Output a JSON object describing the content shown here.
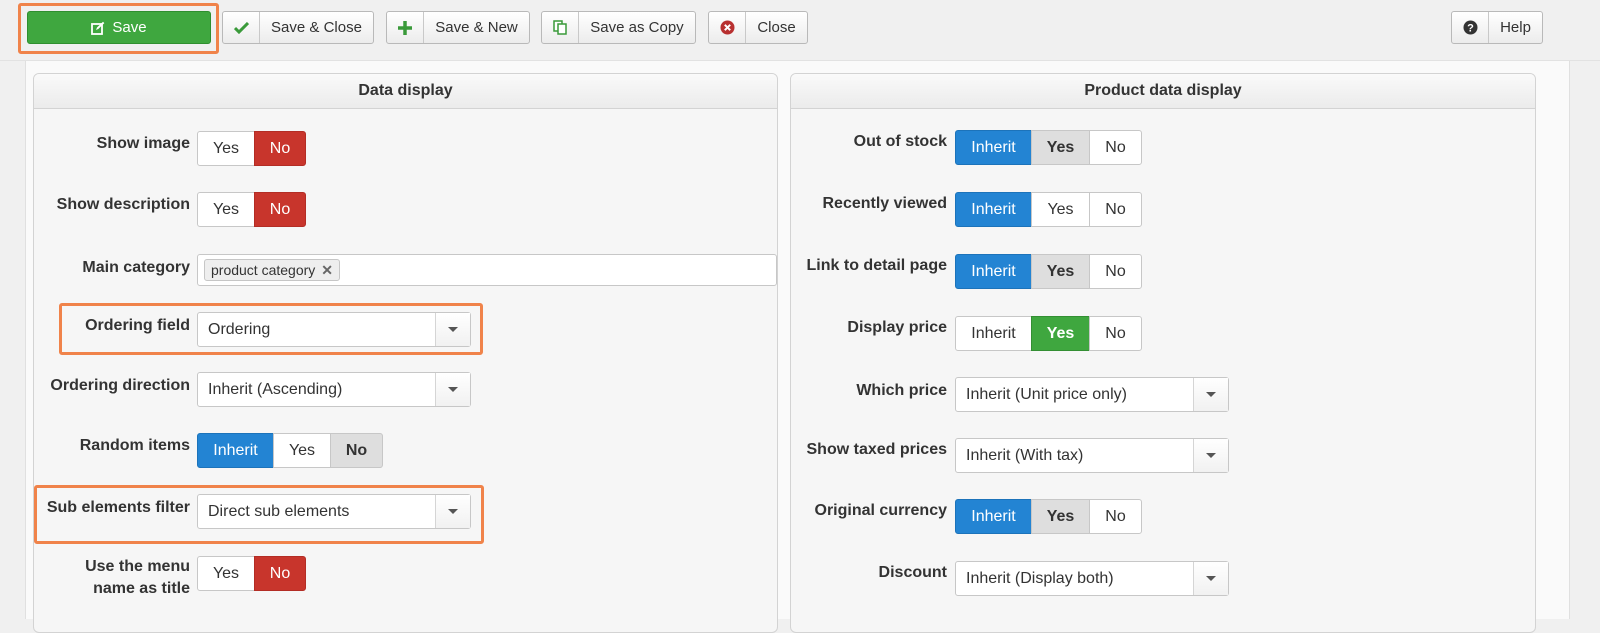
{
  "toolbar": {
    "save": "Save",
    "save_close": "Save & Close",
    "save_new": "Save & New",
    "save_copy": "Save as Copy",
    "close": "Close",
    "help": "Help"
  },
  "data_display": {
    "title": "Data display",
    "show_image": {
      "label": "Show image",
      "options": [
        "Yes",
        "No"
      ],
      "selected": "No"
    },
    "show_description": {
      "label": "Show description",
      "options": [
        "Yes",
        "No"
      ],
      "selected": "No"
    },
    "main_category": {
      "label": "Main category",
      "tags": [
        "product category"
      ]
    },
    "ordering_field": {
      "label": "Ordering field",
      "value": "Ordering"
    },
    "ordering_direction": {
      "label": "Ordering direction",
      "value": "Inherit (Ascending)"
    },
    "random_items": {
      "label": "Random items",
      "options": [
        "Inherit",
        "Yes",
        "No"
      ],
      "selected": "Inherit"
    },
    "sub_elements_filter": {
      "label": "Sub elements filter",
      "value": "Direct sub elements"
    },
    "menu_name_title": {
      "label_line1": "Use the menu",
      "label_line2": "name as title",
      "options": [
        "Yes",
        "No"
      ],
      "selected": "No"
    }
  },
  "product_display": {
    "title": "Product data display",
    "out_of_stock": {
      "label": "Out of stock",
      "options": [
        "Inherit",
        "Yes",
        "No"
      ],
      "selected": "Inherit"
    },
    "recently_viewed": {
      "label": "Recently viewed",
      "options": [
        "Inherit",
        "Yes",
        "No"
      ],
      "selected": "Inherit"
    },
    "link_detail": {
      "label": "Link to detail page",
      "options": [
        "Inherit",
        "Yes",
        "No"
      ],
      "selected": "Inherit"
    },
    "display_price": {
      "label": "Display price",
      "options": [
        "Inherit",
        "Yes",
        "No"
      ],
      "selected": "Yes"
    },
    "which_price": {
      "label": "Which price",
      "value": "Inherit (Unit price only)"
    },
    "show_taxed": {
      "label": "Show taxed prices",
      "value": "Inherit (With tax)"
    },
    "original_currency": {
      "label": "Original currency",
      "options": [
        "Inherit",
        "Yes",
        "No"
      ],
      "selected": "Inherit"
    },
    "discount": {
      "label": "Discount",
      "value": "Inherit (Display both)"
    }
  },
  "colors": {
    "save_green": "#3fa73f",
    "no_red": "#c8352c",
    "inherit_blue": "#2384d3",
    "highlight_orange": "#f0834a"
  }
}
